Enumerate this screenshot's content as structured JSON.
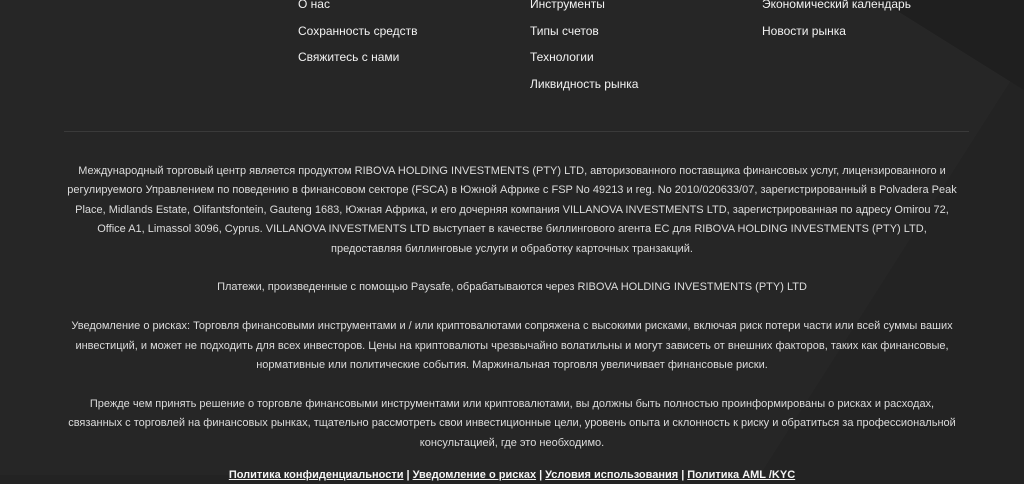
{
  "nav": {
    "col1": [
      "О нас",
      "Сохранность средств",
      "Свяжитесь с нами"
    ],
    "col2": [
      "Инструменты",
      "Типы счетов",
      "Технологии",
      "Ликвидность рынка"
    ],
    "col3": [
      "Экономический календарь",
      "Новости рынка"
    ]
  },
  "legal": {
    "company": "Международный торговый центр является продуктом RIBOVA HOLDING INVESTMENTS (PTY) LTD, авторизованного поставщика финансовых услуг, лицензированного и регулируемого Управлением по поведению в финансовом секторе (FSCA) в Южной Африке с FSP No 49213 и reg. No 2010/020633/07, зарегистрированный в Polvadera Peak Place, Midlands Estate, Olifantsfontein, Gauteng 1683, Южная Африка, и его дочерняя компания VILLANOVA INVESTMENTS LTD, зарегистрированная по адресу Omirou 72, Office A1, Limassol 3096, Cyprus. VILLANOVA INVESTMENTS LTD выступает в качестве биллингового агента ЕС для RIBOVA HOLDING INVESTMENTS (PTY) LTD, предоставляя биллинговые услуги и обработку карточных транзакций.",
    "payments": "Платежи, произведенные с помощью Paysafe, обрабатываются через RIBOVA HOLDING INVESTMENTS (PTY) LTD",
    "risk": "Уведомление о рисках: Торговля финансовыми инструментами и / или криптовалютами сопряжена с высокими рисками, включая риск потери части или всей суммы ваших инвестиций, и может не подходить для всех инвесторов. Цены на криптовалюты чрезвычайно волатильны и могут зависеть от внешних факторов, таких как финансовые, нормативные или политические события. Маржинальная торговля увеличивает финансовые риски.",
    "advice": "Прежде чем принять решение о торговле финансовыми инструментами или криптовалютами, вы должны быть полностью проинформированы о рисках и расходах, связанных с торговлей на финансовых рынках, тщательно рассмотреть свои инвестиционные цели, уровень опыта и склонность к риску и обратиться за профессиональной консультацией, где это необходимо."
  },
  "bottom_links": {
    "privacy": "Политика конфиденциальности",
    "risk_notice": "Уведомление о рисках",
    "terms": "Условия использования",
    "aml": "Политика AML /KYC",
    "separator": "|"
  }
}
